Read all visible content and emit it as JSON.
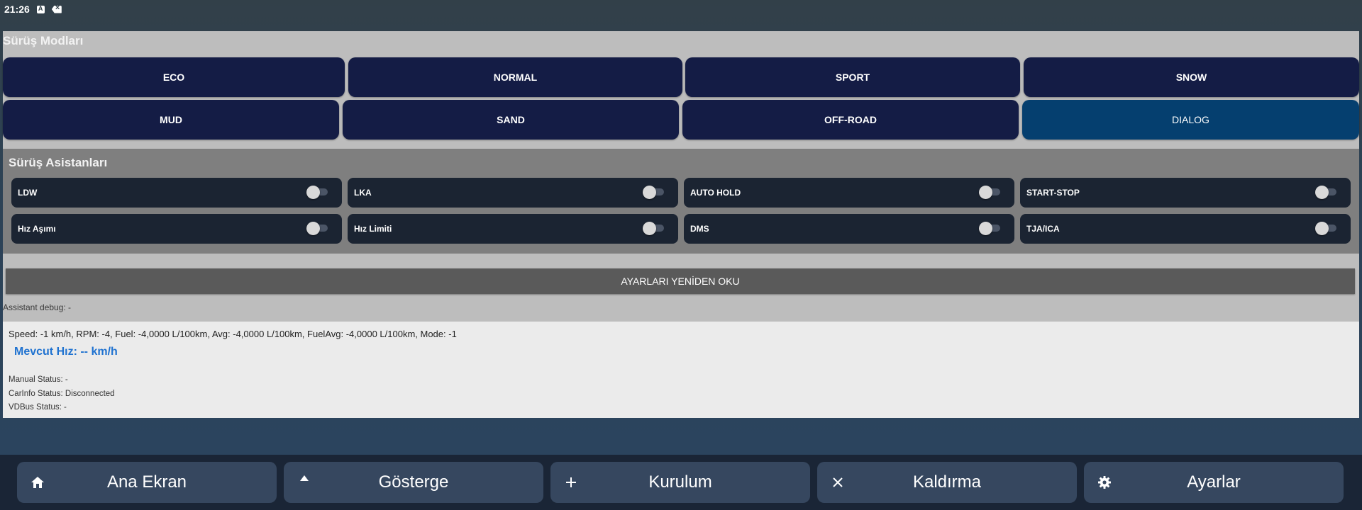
{
  "status_bar": {
    "time": "21:26"
  },
  "modes": {
    "title": "Sürüş Modları",
    "row1": [
      "ECO",
      "NORMAL",
      "SPORT",
      "SNOW"
    ],
    "row2": [
      "MUD",
      "SAND",
      "OFF-ROAD",
      "DIALOG"
    ],
    "active": "DIALOG",
    "active_color": "#053f6f",
    "button_color": "#141c45"
  },
  "assistants": {
    "title": "Sürüş Asistanları",
    "row1": [
      "LDW",
      "LKA",
      "AUTO HOLD",
      "START-STOP"
    ],
    "row2": [
      "Hız Aşımı",
      "Hız Limiti",
      "DMS",
      "TJA/ICA"
    ],
    "all_off": true
  },
  "reload_button": "AYARLARI YENİDEN OKU",
  "debug": "Assistant debug: -",
  "info": {
    "telemetry": "Speed: -1 km/h, RPM: -4, Fuel: -4,0000 L/100km, Avg: -4,0000 L/100km, FuelAvg: -4,0000 L/100km, Mode: -1",
    "speed": "Mevcut Hız: -- km/h",
    "manual_status": "Manual Status: -",
    "carinfo_status": "CarInfo Status: Disconnected",
    "vdbus_status": "VDBus Status: -",
    "speed_color": "#1f72d0"
  },
  "nav": [
    {
      "label": "Ana Ekran",
      "icon": "home-icon"
    },
    {
      "label": "Gösterge",
      "icon": "triangle-up-icon"
    },
    {
      "label": "Kurulum",
      "icon": "plus-icon"
    },
    {
      "label": "Kaldırma",
      "icon": "close-icon"
    },
    {
      "label": "Ayarlar",
      "icon": "gear-icon"
    }
  ]
}
